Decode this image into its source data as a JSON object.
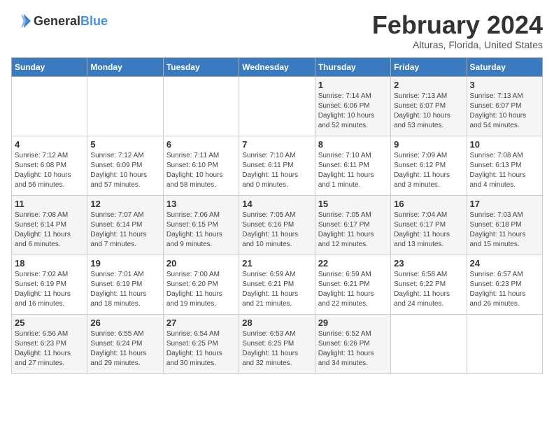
{
  "header": {
    "logo_general": "General",
    "logo_blue": "Blue",
    "title": "February 2024",
    "subtitle": "Alturas, Florida, United States"
  },
  "calendar": {
    "weekdays": [
      "Sunday",
      "Monday",
      "Tuesday",
      "Wednesday",
      "Thursday",
      "Friday",
      "Saturday"
    ],
    "weeks": [
      [
        {
          "day": "",
          "info": ""
        },
        {
          "day": "",
          "info": ""
        },
        {
          "day": "",
          "info": ""
        },
        {
          "day": "",
          "info": ""
        },
        {
          "day": "1",
          "info": "Sunrise: 7:14 AM\nSunset: 6:06 PM\nDaylight: 10 hours\nand 52 minutes."
        },
        {
          "day": "2",
          "info": "Sunrise: 7:13 AM\nSunset: 6:07 PM\nDaylight: 10 hours\nand 53 minutes."
        },
        {
          "day": "3",
          "info": "Sunrise: 7:13 AM\nSunset: 6:07 PM\nDaylight: 10 hours\nand 54 minutes."
        }
      ],
      [
        {
          "day": "4",
          "info": "Sunrise: 7:12 AM\nSunset: 6:08 PM\nDaylight: 10 hours\nand 56 minutes."
        },
        {
          "day": "5",
          "info": "Sunrise: 7:12 AM\nSunset: 6:09 PM\nDaylight: 10 hours\nand 57 minutes."
        },
        {
          "day": "6",
          "info": "Sunrise: 7:11 AM\nSunset: 6:10 PM\nDaylight: 10 hours\nand 58 minutes."
        },
        {
          "day": "7",
          "info": "Sunrise: 7:10 AM\nSunset: 6:11 PM\nDaylight: 11 hours\nand 0 minutes."
        },
        {
          "day": "8",
          "info": "Sunrise: 7:10 AM\nSunset: 6:11 PM\nDaylight: 11 hours\nand 1 minute."
        },
        {
          "day": "9",
          "info": "Sunrise: 7:09 AM\nSunset: 6:12 PM\nDaylight: 11 hours\nand 3 minutes."
        },
        {
          "day": "10",
          "info": "Sunrise: 7:08 AM\nSunset: 6:13 PM\nDaylight: 11 hours\nand 4 minutes."
        }
      ],
      [
        {
          "day": "11",
          "info": "Sunrise: 7:08 AM\nSunset: 6:14 PM\nDaylight: 11 hours\nand 6 minutes."
        },
        {
          "day": "12",
          "info": "Sunrise: 7:07 AM\nSunset: 6:14 PM\nDaylight: 11 hours\nand 7 minutes."
        },
        {
          "day": "13",
          "info": "Sunrise: 7:06 AM\nSunset: 6:15 PM\nDaylight: 11 hours\nand 9 minutes."
        },
        {
          "day": "14",
          "info": "Sunrise: 7:05 AM\nSunset: 6:16 PM\nDaylight: 11 hours\nand 10 minutes."
        },
        {
          "day": "15",
          "info": "Sunrise: 7:05 AM\nSunset: 6:17 PM\nDaylight: 11 hours\nand 12 minutes."
        },
        {
          "day": "16",
          "info": "Sunrise: 7:04 AM\nSunset: 6:17 PM\nDaylight: 11 hours\nand 13 minutes."
        },
        {
          "day": "17",
          "info": "Sunrise: 7:03 AM\nSunset: 6:18 PM\nDaylight: 11 hours\nand 15 minutes."
        }
      ],
      [
        {
          "day": "18",
          "info": "Sunrise: 7:02 AM\nSunset: 6:19 PM\nDaylight: 11 hours\nand 16 minutes."
        },
        {
          "day": "19",
          "info": "Sunrise: 7:01 AM\nSunset: 6:19 PM\nDaylight: 11 hours\nand 18 minutes."
        },
        {
          "day": "20",
          "info": "Sunrise: 7:00 AM\nSunset: 6:20 PM\nDaylight: 11 hours\nand 19 minutes."
        },
        {
          "day": "21",
          "info": "Sunrise: 6:59 AM\nSunset: 6:21 PM\nDaylight: 11 hours\nand 21 minutes."
        },
        {
          "day": "22",
          "info": "Sunrise: 6:59 AM\nSunset: 6:21 PM\nDaylight: 11 hours\nand 22 minutes."
        },
        {
          "day": "23",
          "info": "Sunrise: 6:58 AM\nSunset: 6:22 PM\nDaylight: 11 hours\nand 24 minutes."
        },
        {
          "day": "24",
          "info": "Sunrise: 6:57 AM\nSunset: 6:23 PM\nDaylight: 11 hours\nand 26 minutes."
        }
      ],
      [
        {
          "day": "25",
          "info": "Sunrise: 6:56 AM\nSunset: 6:23 PM\nDaylight: 11 hours\nand 27 minutes."
        },
        {
          "day": "26",
          "info": "Sunrise: 6:55 AM\nSunset: 6:24 PM\nDaylight: 11 hours\nand 29 minutes."
        },
        {
          "day": "27",
          "info": "Sunrise: 6:54 AM\nSunset: 6:25 PM\nDaylight: 11 hours\nand 30 minutes."
        },
        {
          "day": "28",
          "info": "Sunrise: 6:53 AM\nSunset: 6:25 PM\nDaylight: 11 hours\nand 32 minutes."
        },
        {
          "day": "29",
          "info": "Sunrise: 6:52 AM\nSunset: 6:26 PM\nDaylight: 11 hours\nand 34 minutes."
        },
        {
          "day": "",
          "info": ""
        },
        {
          "day": "",
          "info": ""
        }
      ]
    ]
  }
}
